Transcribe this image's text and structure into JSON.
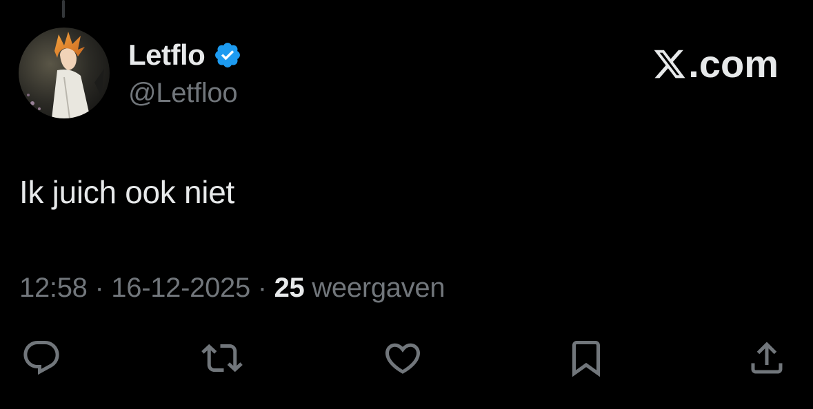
{
  "tweet": {
    "author": {
      "display_name": "Letflo",
      "handle": "@Letfloo",
      "verified": true
    },
    "brand": {
      "text": ".com",
      "icon": "x-logo-icon"
    },
    "text": "Ik juich ook niet",
    "meta": {
      "time": "12:58",
      "separator": "·",
      "date": "16-12-2025",
      "views_count": "25",
      "views_label": "weergaven"
    },
    "actions": [
      {
        "name": "reply",
        "icon": "reply-icon"
      },
      {
        "name": "repost",
        "icon": "repost-icon"
      },
      {
        "name": "like",
        "icon": "heart-icon"
      },
      {
        "name": "bookmark",
        "icon": "bookmark-icon"
      },
      {
        "name": "share",
        "icon": "share-icon"
      }
    ]
  },
  "colors": {
    "background": "#000000",
    "primary_text": "#e7e9ea",
    "secondary_text": "#71767b",
    "verified_blue": "#1d9bf0"
  }
}
